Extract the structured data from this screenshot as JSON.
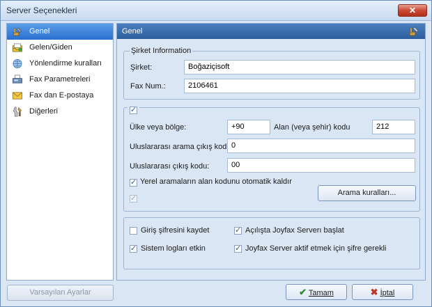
{
  "window": {
    "title": "Server Seçenekleri",
    "close": "✕"
  },
  "sidebar": {
    "items": [
      {
        "label": "Genel",
        "icon": "tools-icon",
        "selected": true
      },
      {
        "label": "Gelen/Giden",
        "icon": "inbox-icon"
      },
      {
        "label": "Yönlendirme kuralları",
        "icon": "routing-icon"
      },
      {
        "label": "Fax Parametreleri",
        "icon": "fax-icon"
      },
      {
        "label": "Fax dan E-postaya",
        "icon": "envelope-icon"
      },
      {
        "label": "Diğerleri",
        "icon": "settings-icon"
      }
    ]
  },
  "panel": {
    "title": "Genel"
  },
  "company": {
    "legend": "Şirket Information",
    "company_label": "Şirket:",
    "company_value": "Boğaziçisoft",
    "fax_label": "Fax Num.:",
    "fax_value": "2106461"
  },
  "dialing": {
    "country_label": "Ülke veya bölge:",
    "country_value": "+90",
    "area_label": "Alan (veya şehir) kodu",
    "area_value": "212",
    "intl_prefix_label": "Uluslararası arama çıkış kodu:",
    "intl_prefix_value": "0",
    "intl_exit_label": "Uluslararası çıkış kodu:",
    "intl_exit_value": "00",
    "remove_area_label": "Yerel aramaların alan kodunu otomatik kaldır",
    "rules_button": "Arama kuralları..."
  },
  "options": {
    "save_login": "Giriş şifresini kaydet",
    "start_server": "Açılışta Joyfax Serverı başlat",
    "system_logs": "Sistem logları etkin",
    "password_required": "Joyfax Server aktif etmek için şifre gerekli"
  },
  "footer": {
    "defaults": "Varsayılan Ayarlar",
    "ok": "Tamam",
    "cancel": "İptal"
  },
  "colors": {
    "accent": "#2d5f9f",
    "selection": "#3d84dc"
  }
}
